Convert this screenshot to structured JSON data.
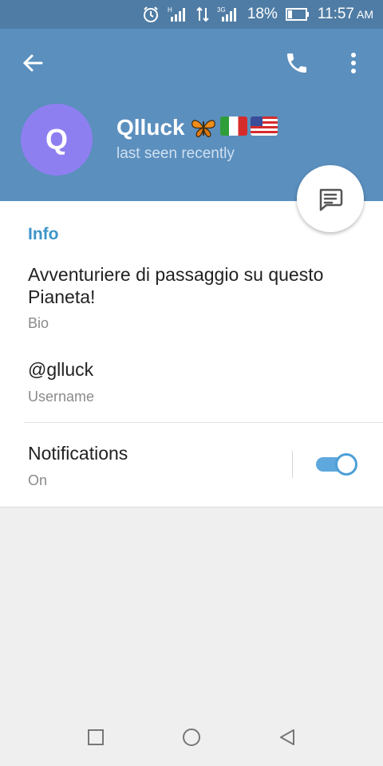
{
  "status_bar": {
    "network_h": "H",
    "network_3g": "3G",
    "battery": "18%",
    "time": "11:57",
    "am_pm": "AM"
  },
  "header": {
    "avatar_letter": "Q",
    "name": "Qlluck",
    "name_emojis": [
      "butterfly",
      "flag-italy",
      "flag-usa"
    ],
    "status": "last seen recently"
  },
  "info": {
    "section_title": "Info",
    "bio": "Avventuriere di passaggio su questo Pianeta!",
    "bio_label": "Bio",
    "username": "@glluck",
    "username_label": "Username",
    "notifications_title": "Notifications",
    "notifications_value": "On",
    "notifications_enabled": true
  },
  "colors": {
    "header_bg": "#5b8fbe",
    "status_bar_bg": "#4f7ca4",
    "avatar_bg": "#8e7ff1",
    "accent": "#3e95c9",
    "toggle_on": "#5ea8dd"
  }
}
